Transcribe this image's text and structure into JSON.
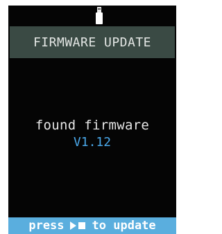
{
  "header": {
    "title": "FIRMWARE UPDATE"
  },
  "main": {
    "status": "found firmware",
    "version": "V1.12"
  },
  "footer": {
    "prefix": "press",
    "action_icon": "play-pause-icon",
    "suffix": "to update"
  },
  "top_icon": "usb-drive-icon",
  "colors": {
    "background": "#050505",
    "header_bg": "#3a4a44",
    "version": "#4aa8ea",
    "footer_bg": "#5aaede"
  }
}
